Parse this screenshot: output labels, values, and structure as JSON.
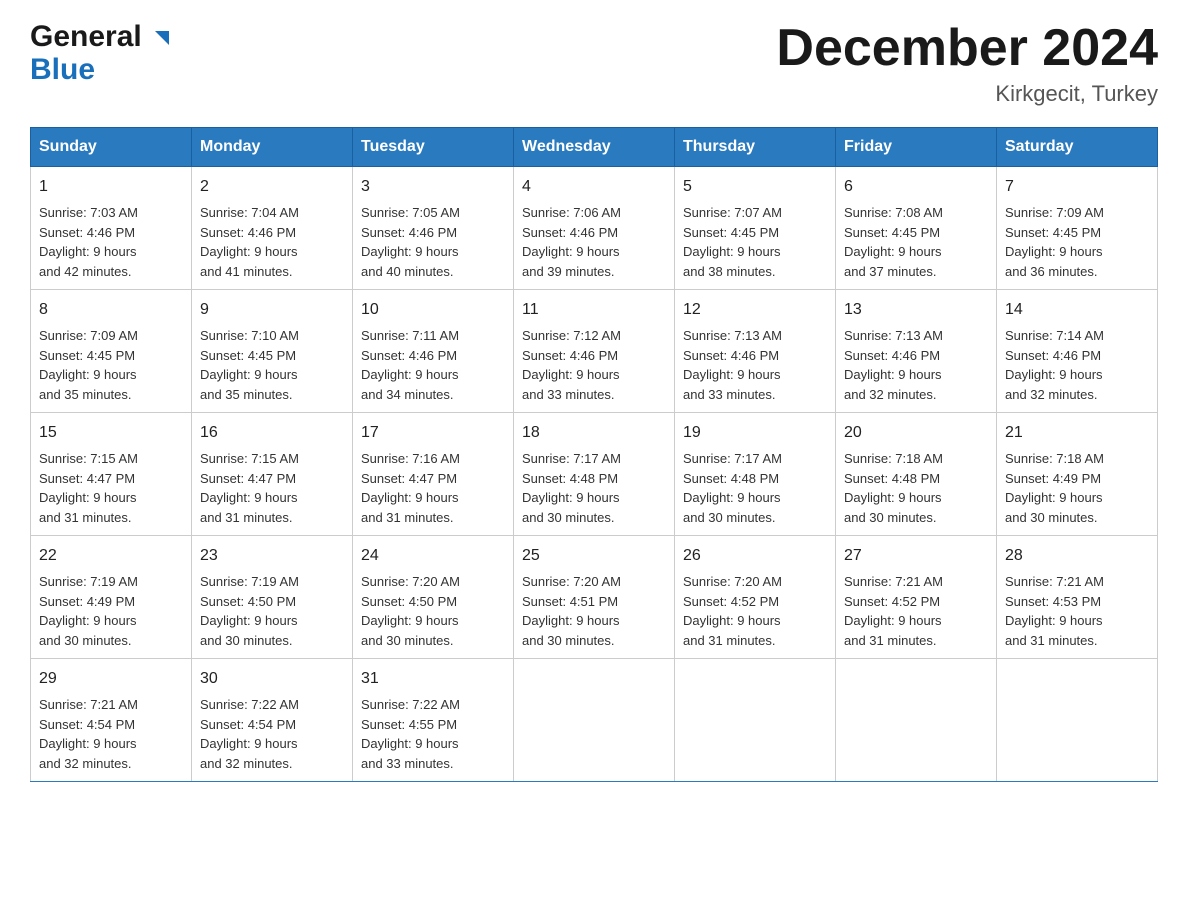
{
  "header": {
    "logo_general": "General",
    "logo_blue": "Blue",
    "month_title": "December 2024",
    "location": "Kirkgecit, Turkey"
  },
  "weekdays": [
    "Sunday",
    "Monday",
    "Tuesday",
    "Wednesday",
    "Thursday",
    "Friday",
    "Saturday"
  ],
  "weeks": [
    [
      {
        "day": "1",
        "sunrise": "7:03 AM",
        "sunset": "4:46 PM",
        "daylight": "9 hours and 42 minutes."
      },
      {
        "day": "2",
        "sunrise": "7:04 AM",
        "sunset": "4:46 PM",
        "daylight": "9 hours and 41 minutes."
      },
      {
        "day": "3",
        "sunrise": "7:05 AM",
        "sunset": "4:46 PM",
        "daylight": "9 hours and 40 minutes."
      },
      {
        "day": "4",
        "sunrise": "7:06 AM",
        "sunset": "4:46 PM",
        "daylight": "9 hours and 39 minutes."
      },
      {
        "day": "5",
        "sunrise": "7:07 AM",
        "sunset": "4:45 PM",
        "daylight": "9 hours and 38 minutes."
      },
      {
        "day": "6",
        "sunrise": "7:08 AM",
        "sunset": "4:45 PM",
        "daylight": "9 hours and 37 minutes."
      },
      {
        "day": "7",
        "sunrise": "7:09 AM",
        "sunset": "4:45 PM",
        "daylight": "9 hours and 36 minutes."
      }
    ],
    [
      {
        "day": "8",
        "sunrise": "7:09 AM",
        "sunset": "4:45 PM",
        "daylight": "9 hours and 35 minutes."
      },
      {
        "day": "9",
        "sunrise": "7:10 AM",
        "sunset": "4:45 PM",
        "daylight": "9 hours and 35 minutes."
      },
      {
        "day": "10",
        "sunrise": "7:11 AM",
        "sunset": "4:46 PM",
        "daylight": "9 hours and 34 minutes."
      },
      {
        "day": "11",
        "sunrise": "7:12 AM",
        "sunset": "4:46 PM",
        "daylight": "9 hours and 33 minutes."
      },
      {
        "day": "12",
        "sunrise": "7:13 AM",
        "sunset": "4:46 PM",
        "daylight": "9 hours and 33 minutes."
      },
      {
        "day": "13",
        "sunrise": "7:13 AM",
        "sunset": "4:46 PM",
        "daylight": "9 hours and 32 minutes."
      },
      {
        "day": "14",
        "sunrise": "7:14 AM",
        "sunset": "4:46 PM",
        "daylight": "9 hours and 32 minutes."
      }
    ],
    [
      {
        "day": "15",
        "sunrise": "7:15 AM",
        "sunset": "4:47 PM",
        "daylight": "9 hours and 31 minutes."
      },
      {
        "day": "16",
        "sunrise": "7:15 AM",
        "sunset": "4:47 PM",
        "daylight": "9 hours and 31 minutes."
      },
      {
        "day": "17",
        "sunrise": "7:16 AM",
        "sunset": "4:47 PM",
        "daylight": "9 hours and 31 minutes."
      },
      {
        "day": "18",
        "sunrise": "7:17 AM",
        "sunset": "4:48 PM",
        "daylight": "9 hours and 30 minutes."
      },
      {
        "day": "19",
        "sunrise": "7:17 AM",
        "sunset": "4:48 PM",
        "daylight": "9 hours and 30 minutes."
      },
      {
        "day": "20",
        "sunrise": "7:18 AM",
        "sunset": "4:48 PM",
        "daylight": "9 hours and 30 minutes."
      },
      {
        "day": "21",
        "sunrise": "7:18 AM",
        "sunset": "4:49 PM",
        "daylight": "9 hours and 30 minutes."
      }
    ],
    [
      {
        "day": "22",
        "sunrise": "7:19 AM",
        "sunset": "4:49 PM",
        "daylight": "9 hours and 30 minutes."
      },
      {
        "day": "23",
        "sunrise": "7:19 AM",
        "sunset": "4:50 PM",
        "daylight": "9 hours and 30 minutes."
      },
      {
        "day": "24",
        "sunrise": "7:20 AM",
        "sunset": "4:50 PM",
        "daylight": "9 hours and 30 minutes."
      },
      {
        "day": "25",
        "sunrise": "7:20 AM",
        "sunset": "4:51 PM",
        "daylight": "9 hours and 30 minutes."
      },
      {
        "day": "26",
        "sunrise": "7:20 AM",
        "sunset": "4:52 PM",
        "daylight": "9 hours and 31 minutes."
      },
      {
        "day": "27",
        "sunrise": "7:21 AM",
        "sunset": "4:52 PM",
        "daylight": "9 hours and 31 minutes."
      },
      {
        "day": "28",
        "sunrise": "7:21 AM",
        "sunset": "4:53 PM",
        "daylight": "9 hours and 31 minutes."
      }
    ],
    [
      {
        "day": "29",
        "sunrise": "7:21 AM",
        "sunset": "4:54 PM",
        "daylight": "9 hours and 32 minutes."
      },
      {
        "day": "30",
        "sunrise": "7:22 AM",
        "sunset": "4:54 PM",
        "daylight": "9 hours and 32 minutes."
      },
      {
        "day": "31",
        "sunrise": "7:22 AM",
        "sunset": "4:55 PM",
        "daylight": "9 hours and 33 minutes."
      },
      null,
      null,
      null,
      null
    ]
  ],
  "labels": {
    "sunrise": "Sunrise:",
    "sunset": "Sunset:",
    "daylight": "Daylight:"
  }
}
